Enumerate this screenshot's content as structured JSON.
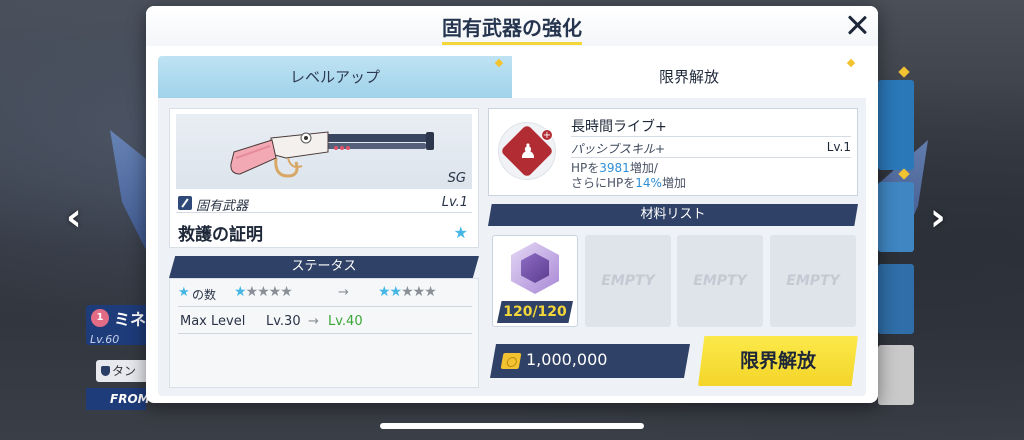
{
  "background": {
    "character_name": "ミネ",
    "character_level": "Lv.60",
    "role_label": "タン",
    "from_label": "FROM",
    "heart": "1"
  },
  "nav": {
    "left_arrow": "‹",
    "right_arrow": "›"
  },
  "modal": {
    "title": "固有武器の強化",
    "close_icon": "close-icon"
  },
  "tabs": [
    {
      "label": "レベルアップ",
      "active": false
    },
    {
      "label": "限界解放",
      "active": true
    }
  ],
  "weapon": {
    "type_tag": "SG",
    "category": "固有武器",
    "level": "Lv.1",
    "name": "救護の証明"
  },
  "status": {
    "header": "ステータス",
    "star_count_label": "の数",
    "stars_from": {
      "on": 1,
      "off": 4
    },
    "stars_to": {
      "on": 2,
      "off": 3
    },
    "arrow": "→",
    "max_level_label": "Max Level",
    "max_level_from": "Lv.30",
    "max_level_to": "Lv.40"
  },
  "skill": {
    "name": "長時間ライブ+",
    "type": "パッシブスキル+",
    "level": "Lv.1",
    "desc_line1_pre": "HPを",
    "desc_line1_value": "3981",
    "desc_line1_post": "増加/",
    "desc_line2_pre": "さらにHPを",
    "desc_line2_value": "14%",
    "desc_line2_post": "増加"
  },
  "materials": {
    "header": "材料リスト",
    "filled_count": "120/120",
    "empty_label": "EMPTY"
  },
  "cost": {
    "value": "1,000,000"
  },
  "action_button": {
    "label": "限界解放"
  },
  "colors": {
    "accent_yellow": "#f4d52a",
    "navy": "#2f4166",
    "highlight_blue": "#2f8fd6",
    "level_green": "#3aa637",
    "star_blue": "#46b6e4"
  }
}
